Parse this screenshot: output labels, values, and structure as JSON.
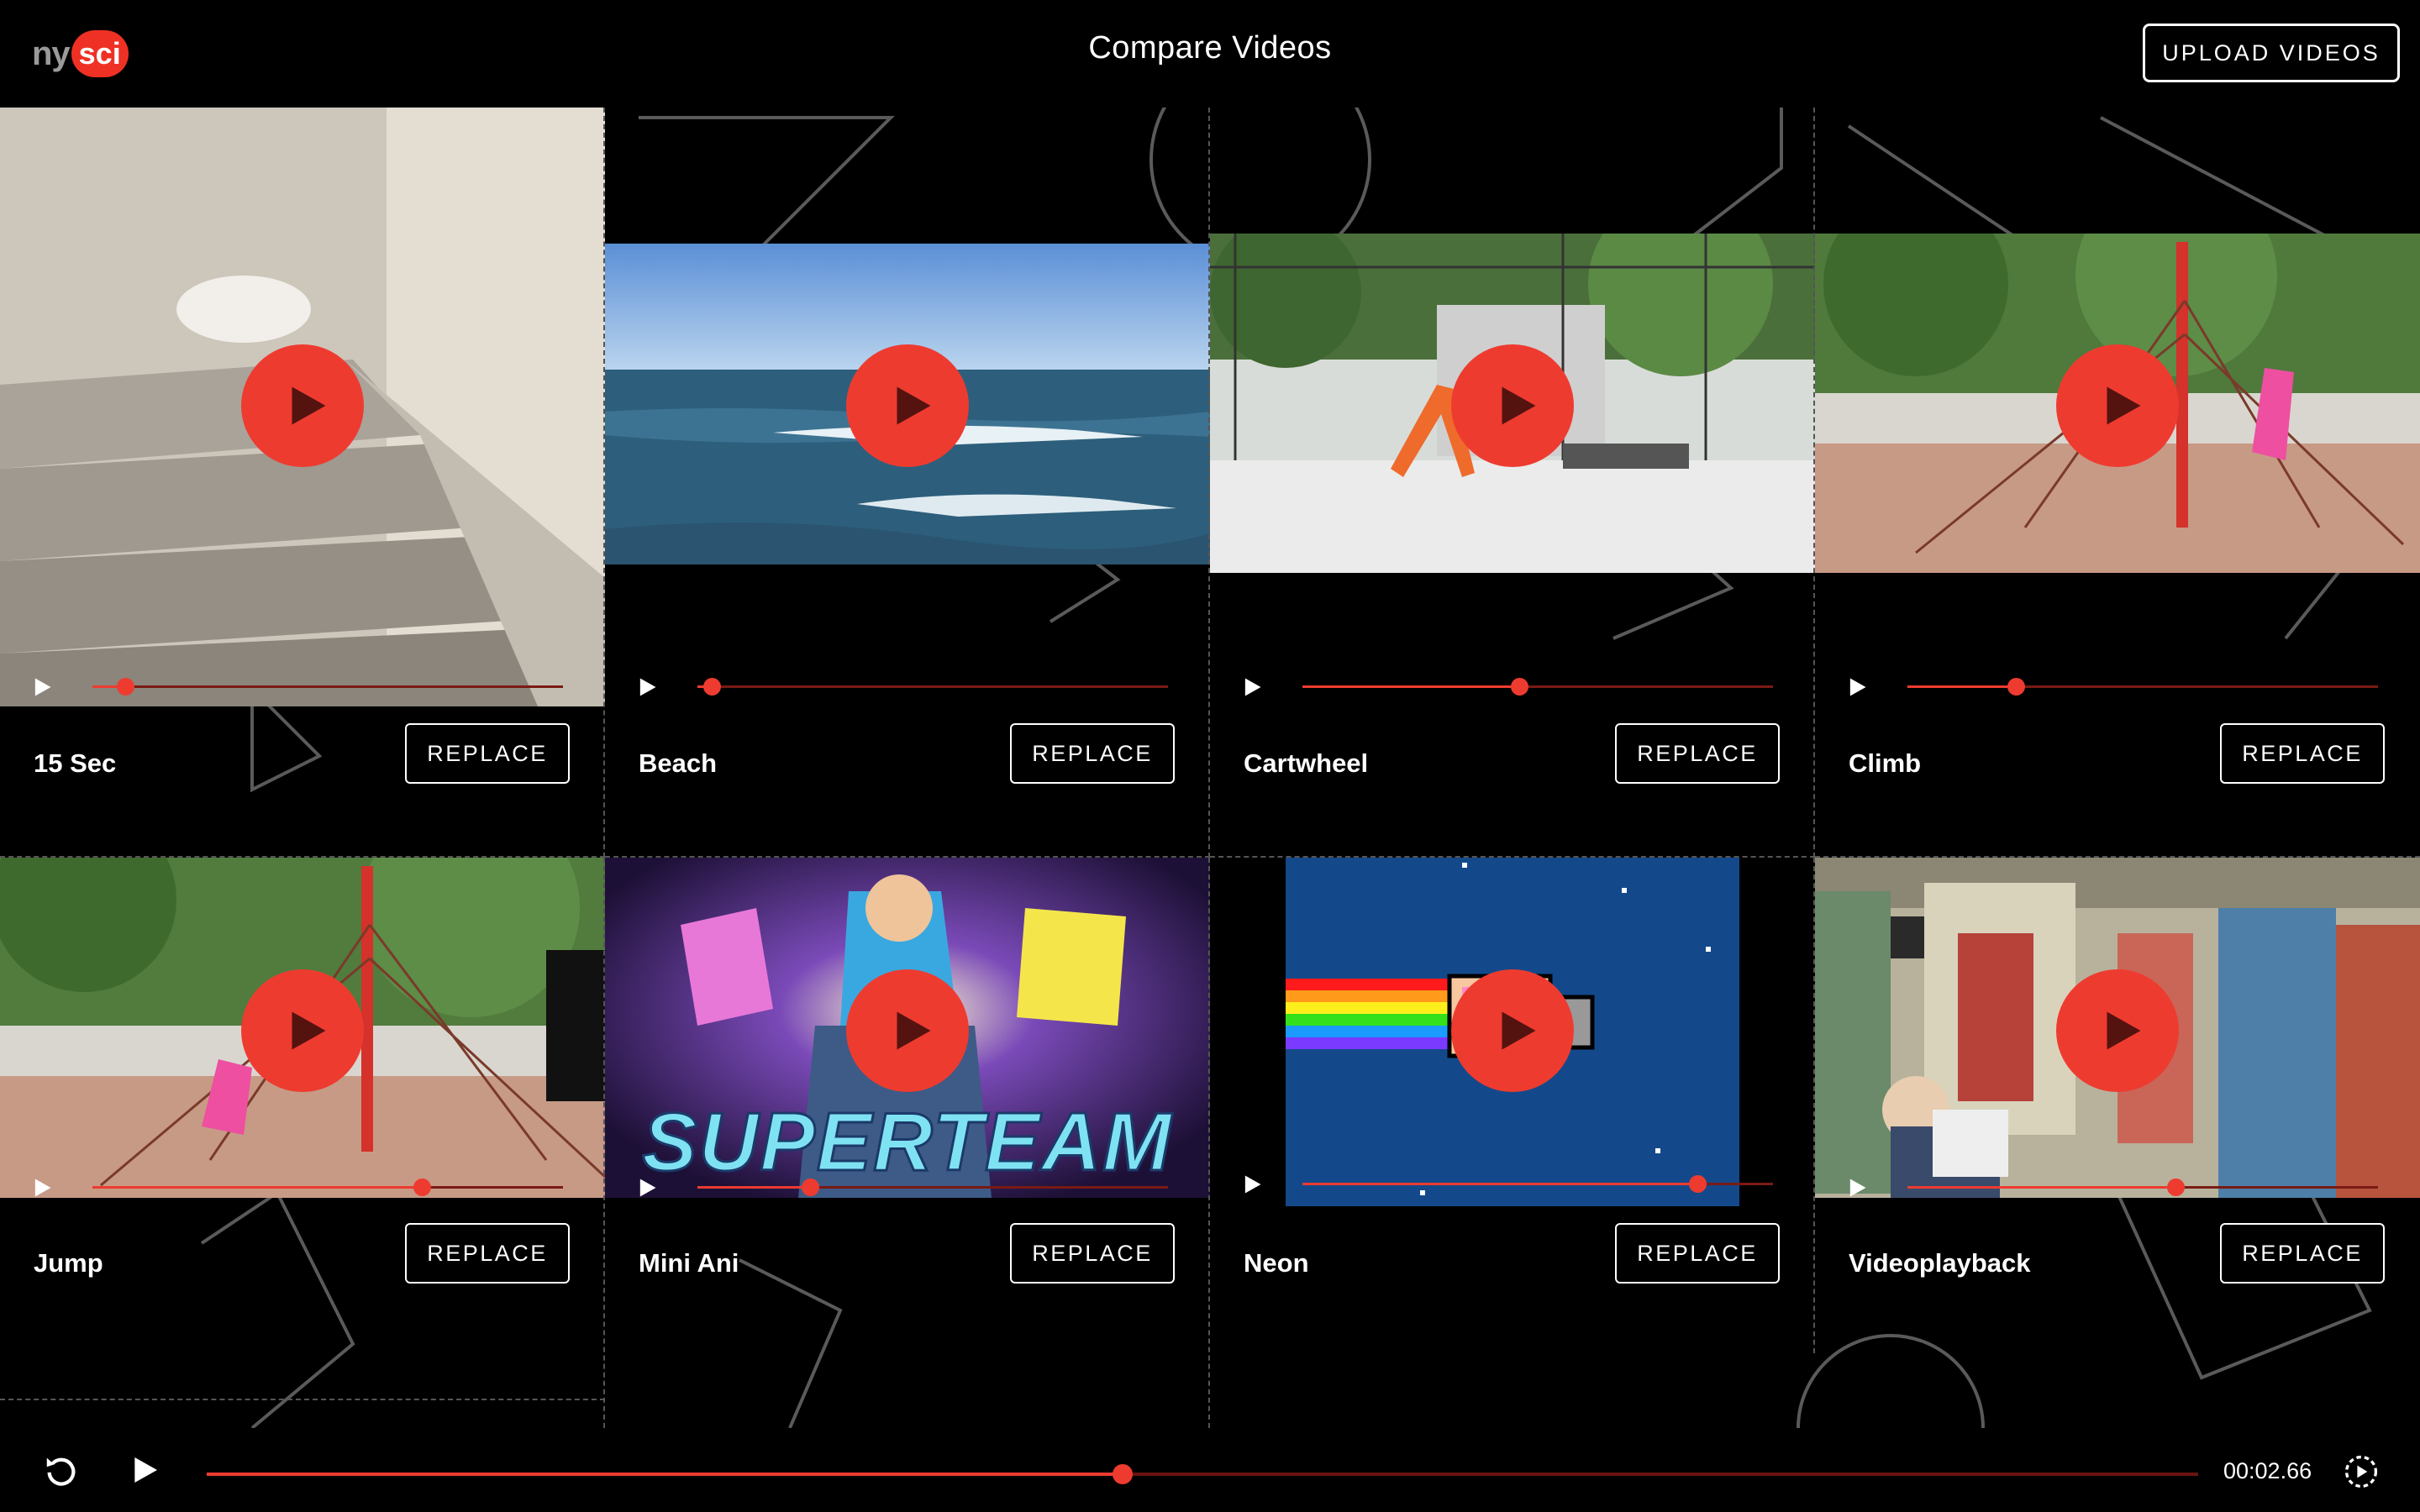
{
  "header": {
    "logo_ny": "ny",
    "logo_sci": "sci",
    "title": "Compare Videos",
    "upload_label": "UPLOAD VIDEOS"
  },
  "colors": {
    "accent": "#ee3b30",
    "background": "#000000",
    "text": "#ffffff"
  },
  "videos": [
    {
      "name": "15 Sec",
      "replace_label": "REPLACE",
      "progress": 0.07,
      "thumbnail": "cat-on-stairs"
    },
    {
      "name": "Beach",
      "replace_label": "REPLACE",
      "progress": 0.03,
      "thumbnail": "ocean-waves"
    },
    {
      "name": "Cartwheel",
      "replace_label": "REPLACE",
      "progress": 0.46,
      "thumbnail": "cartwheel-park"
    },
    {
      "name": "Climb",
      "replace_label": "REPLACE",
      "progress": 0.23,
      "thumbnail": "climbing-playground"
    },
    {
      "name": "Jump",
      "replace_label": "REPLACE",
      "progress": 0.7,
      "thumbnail": "jump-playground"
    },
    {
      "name": "Mini Ani",
      "replace_label": "REPLACE",
      "progress": 0.24,
      "thumbnail": "super-team-cartoon"
    },
    {
      "name": "Neon",
      "replace_label": "REPLACE",
      "progress": 0.84,
      "thumbnail": "nyan-cat"
    },
    {
      "name": "Videoplayback",
      "replace_label": "REPLACE",
      "progress": 0.57,
      "thumbnail": "anime-train"
    }
  ],
  "thumbnail_text": {
    "mini_ani": "SUPERTEAM"
  },
  "footer": {
    "timecode": "00:02.66",
    "progress": 0.46
  }
}
